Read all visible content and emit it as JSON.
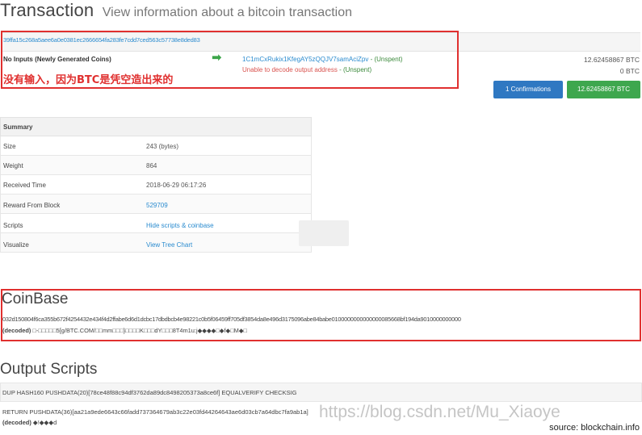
{
  "header": {
    "title": "Transaction",
    "subtitle": "View information about a bitcoin transaction"
  },
  "transaction": {
    "hash": "39ffa15c268a5aee6a0e0381ec2666654fa283fe7cdd7ced563c57738e8ded83",
    "inputs_label": "No Inputs (Newly Generated Coins)",
    "arrow": "➡",
    "outputs": [
      {
        "address": "1C1mCxRukix1KfegAY5zQQJV7samAciZpv",
        "status": " - (Unspent)",
        "amount": "12.62458867 BTC"
      },
      {
        "address": "Unable to decode output address",
        "status": " - (Unspent)",
        "amount": "0 BTC"
      }
    ],
    "annotation": "没有输入，因为BTC是凭空造出来的",
    "confirmations_label": "1 Confirmations",
    "total_label": "12.62458867 BTC"
  },
  "summary": {
    "heading": "Summary",
    "rows": [
      {
        "label": "Size",
        "value": "243 (bytes)"
      },
      {
        "label": "Weight",
        "value": "864"
      },
      {
        "label": "Received Time",
        "value": "2018-06-29 06:17:26"
      },
      {
        "label": "Reward From Block",
        "value": "529709"
      },
      {
        "label": "Scripts",
        "value": "Hide scripts & coinbase"
      },
      {
        "label": "Visualize",
        "value": "View Tree Chart"
      }
    ]
  },
  "coinbase": {
    "title": "CoinBase",
    "hex": "032d150804f6ca355b672f4254432e434f4d2ffabe6d6d1dcbc17dbdbcb4e98221c0b5f06459ff705df3854da8e496d3175096abe84babe0100000000000000085668bf194da9010000000000",
    "decoded_label": "(decoded)",
    "decoded_text": " □-□□□□□5[g/BTC.COM/□□mm□□□}□□□□K□□□dY□□□8T4m1u:j◆◆◆◆□◆f◆□M◆□"
  },
  "output_scripts": {
    "title": "Output Scripts",
    "line1": "DUP HASH160 PUSHDATA(20)[78ce48f88c94df3762da89dc8498205373a8ce6f] EQUALVERIFY CHECKSIG",
    "line2": "RETURN PUSHDATA(36)[aa21a9ede6643c66fadd737364679ab3c22e03fd44264643ae6d03cb7a64dbc7fa9ab1a]",
    "decoded_label": "(decoded)",
    "decoded_text": " ◆!◆◆◆d"
  },
  "watermark": "https://blog.csdn.net/Mu_Xiaoye",
  "source": "source: blockchain.info",
  "colors": {
    "link": "#2a8bcf",
    "highlight_border": "#e0302f",
    "confirm_button": "#2f78c2",
    "total_button": "#3ea74e"
  }
}
